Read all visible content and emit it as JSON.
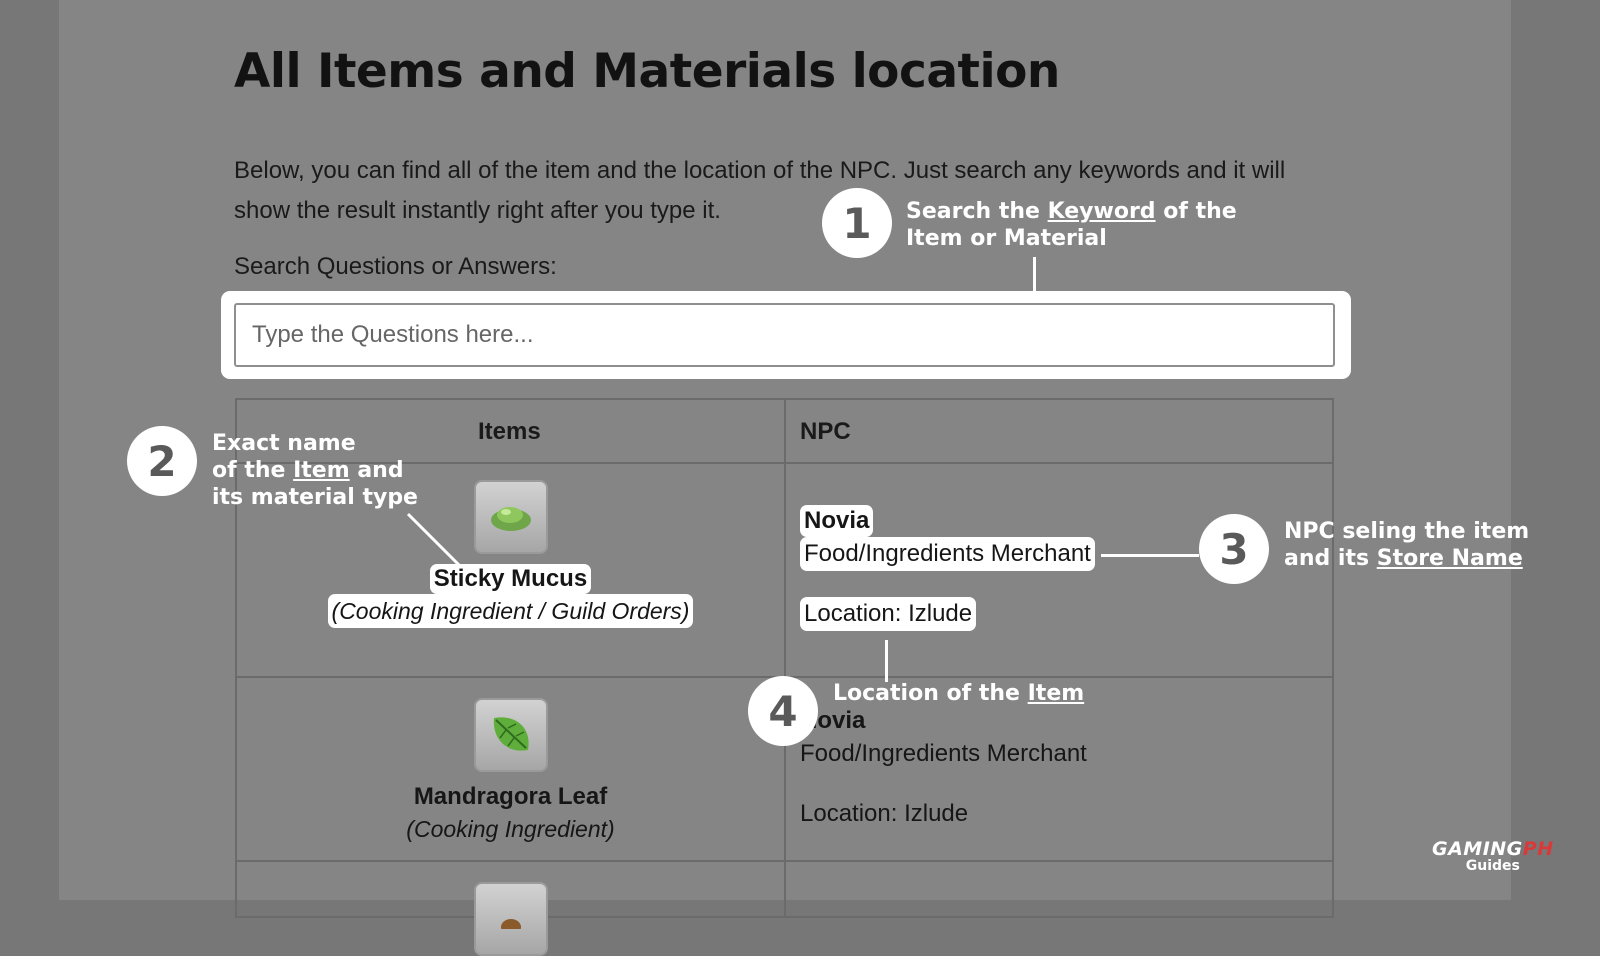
{
  "page": {
    "title": "All Items and Materials location",
    "intro": "Below, you can find all of the item and the location of the NPC. Just search any keywords and it will show the result instantly right after you type it.",
    "search_label": "Search Questions or Answers:",
    "search_placeholder": "Type the Questions here...",
    "search_value": ""
  },
  "table": {
    "headers": [
      "Items",
      "NPC"
    ],
    "rows": [
      {
        "item_name": "Sticky Mucus",
        "item_type": "(Cooking Ingredient / Guild Orders)",
        "icon": "sticky-mucus-icon",
        "npc_name": "Novia",
        "npc_store": "Food/Ingredients Merchant",
        "npc_location": "Location: Izlude"
      },
      {
        "item_name": "Mandragora Leaf",
        "item_type": "(Cooking Ingredient)",
        "icon": "mandragora-leaf-icon",
        "npc_name": "Novia",
        "npc_store": "Food/Ingredients Merchant",
        "npc_location": "Location: Izlude"
      }
    ]
  },
  "annotations": [
    {
      "number": "1",
      "text_parts": [
        "Search the ",
        "Keyword",
        " of the",
        "Item or Material"
      ]
    },
    {
      "number": "2",
      "text_parts": [
        "Exact name",
        "of the ",
        "Item",
        " and",
        "its material type"
      ]
    },
    {
      "number": "3",
      "text_parts": [
        "NPC seling the item",
        "and its ",
        "Store Name"
      ]
    },
    {
      "number": "4",
      "text_parts": [
        "Location of the ",
        "Item"
      ]
    }
  ],
  "watermark": {
    "brand_main": "GAMING",
    "brand_accent": "PH",
    "sub": "Guides"
  },
  "colors": {
    "overlay": "#858585",
    "highlight": "#ffffff",
    "accent": "#d83a3a"
  }
}
